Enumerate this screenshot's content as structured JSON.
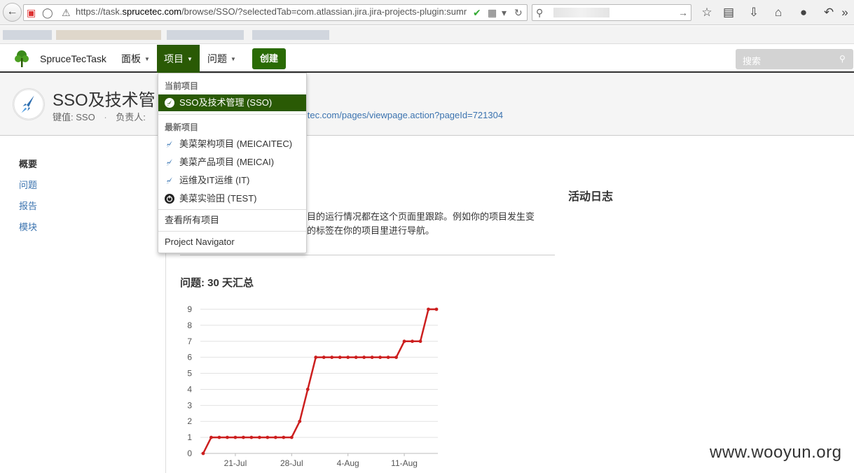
{
  "browser": {
    "url_prefix": "https://task.",
    "url_domain": "sprucetec.com",
    "url_rest": "/browse/SSO/?selectedTab=com.atlassian.jira.jira-projects-plugin:sumr"
  },
  "header": {
    "app_name": "SpruceTecTask",
    "nav": {
      "dashboards": "面板",
      "projects": "项目",
      "issues": "问题"
    },
    "create": "创建",
    "search_placeholder": "搜索"
  },
  "project": {
    "title": "SSO及技术管",
    "key_label": "键值: SSO",
    "lead_label": "负责人:",
    "url_fragment": "cetec.com/pages/viewpage.action?pageId=721304"
  },
  "dropdown": {
    "current_header": "当前项目",
    "current": "SSO及技术管理 (SSO)",
    "recent_header": "最新项目",
    "recent": [
      "美菜架构项目 (MEICAITEC)",
      "美菜产品项目 (MEICAI)",
      "运维及IT运维 (IT)",
      "美菜实验田 (TEST)"
    ],
    "view_all": "查看所有项目",
    "navigator": "Project Navigator"
  },
  "sidebar": {
    "items": [
      "概要",
      "问题",
      "报告",
      "模块"
    ]
  },
  "main": {
    "activity_title": "活动日志",
    "intro_line1": "目的运行情况都在这个页面里跟踪。例如你的项目发生变",
    "intro_line2": "的标签在你的项目里进行导航。",
    "chart_title": "问题: 30 天汇总"
  },
  "chart_data": {
    "type": "line",
    "x_tick_labels": [
      "21-Jul",
      "28-Jul",
      "4-Aug",
      "11-Aug"
    ],
    "y_ticks": [
      0,
      1,
      2,
      3,
      4,
      5,
      6,
      7,
      8,
      9
    ],
    "ylim": [
      0,
      9
    ],
    "series": [
      {
        "color": "#cc1f1f",
        "values": [
          0,
          1,
          1,
          1,
          1,
          1,
          1,
          1,
          1,
          1,
          1,
          1,
          2,
          4,
          6,
          6,
          6,
          6,
          6,
          6,
          6,
          6,
          6,
          6,
          6,
          7,
          7,
          7,
          9,
          9
        ]
      }
    ]
  },
  "watermark": "www.wooyun.org",
  "colors": {
    "accent": "#2a5a05",
    "link": "#3b73af",
    "series": "#cc1f1f"
  }
}
